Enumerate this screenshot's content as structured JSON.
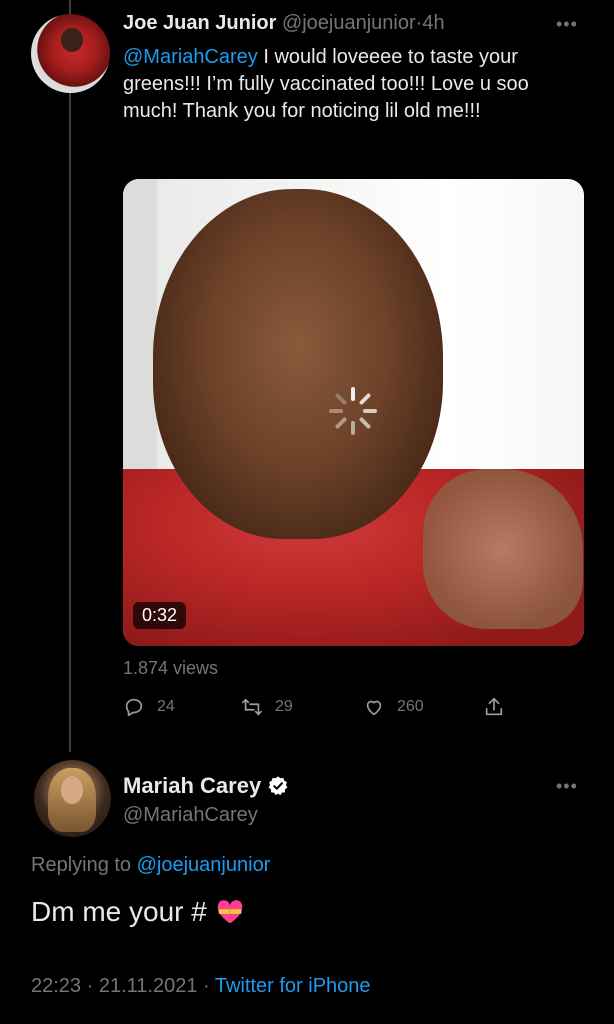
{
  "tweet1": {
    "display_name": "Joe Juan Junior",
    "handle": "@joejuanjunior",
    "separator": "·",
    "time": "4h",
    "mention": "@MariahCarey",
    "text": " I would loveeee to taste your greens!!! I’m fully vaccinated too!!! Love u soo much! Thank you for noticing lil old me!!!",
    "video_duration": "0:32",
    "views": "1.874 views",
    "reply_count": "24",
    "retweet_count": "29",
    "like_count": "260",
    "more_icon": "more-dots-icon"
  },
  "tweet2": {
    "display_name": "Mariah Carey",
    "handle": "@MariahCarey",
    "replying_prefix": "Replying to ",
    "replying_to": "@joejuanjunior",
    "text": "Dm me your #",
    "emoji": "heart-with-ribbon-icon",
    "time": "22:23",
    "date": "21.11.2021",
    "sep": "·",
    "client": "Twitter for iPhone",
    "more_icon": "more-dots-icon"
  },
  "colors": {
    "background": "#000000",
    "text": "#e7e9ea",
    "muted": "#71767b",
    "accent": "#1d9bf0"
  }
}
